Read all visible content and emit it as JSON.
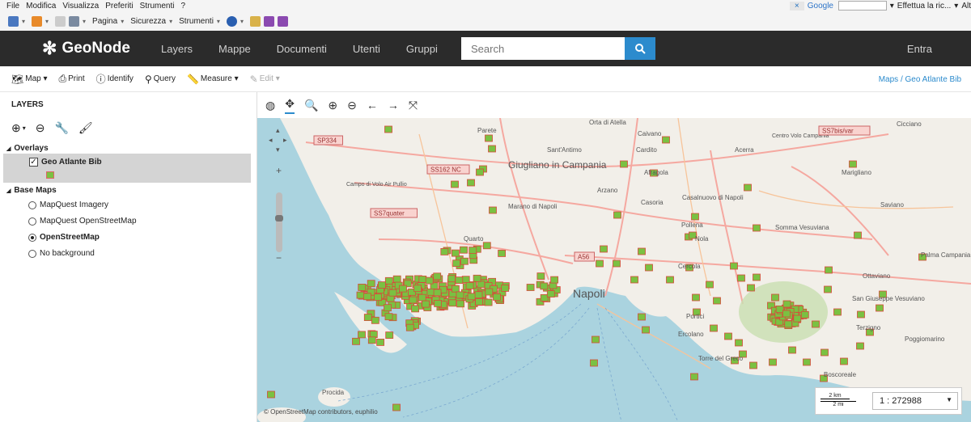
{
  "ie": {
    "menu": [
      "File",
      "Modifica",
      "Visualizza",
      "Preferiti",
      "Strumenti",
      "?"
    ],
    "commands": [
      "Pagina",
      "Sicurezza",
      "Strumenti"
    ],
    "search_provider": "Google",
    "search_label": "Effettua la ric...",
    "search_more": "Alt"
  },
  "navbar": {
    "brand": "GeoNode",
    "items": [
      "Layers",
      "Mappe",
      "Documenti",
      "Utenti",
      "Gruppi"
    ],
    "search_placeholder": "Search",
    "login": "Entra"
  },
  "toolbar": {
    "map": "Map",
    "print": "Print",
    "identify": "Identify",
    "query": "Query",
    "measure": "Measure",
    "edit": "Edit",
    "breadcrumb": "Maps / Geo Atlante Bib"
  },
  "layers_panel": {
    "title": "LAYERS",
    "overlays_label": "Overlays",
    "overlay_layer": "Geo Atlante Bib",
    "basemaps_label": "Base Maps",
    "basemaps": [
      {
        "label": "MapQuest Imagery",
        "selected": false
      },
      {
        "label": "MapQuest OpenStreetMap",
        "selected": false
      },
      {
        "label": "OpenStreetMap",
        "selected": true
      },
      {
        "label": "No background",
        "selected": false
      }
    ]
  },
  "map": {
    "labels": [
      "Orta di Atella",
      "Caivano",
      "Cicciano",
      "Parete",
      "Sant'Antimo",
      "Cardito",
      "Acerra",
      "Centro Volo Campania",
      "Giugliano in Campania",
      "Afragola",
      "Marigliano",
      "Campo di Volo Air Pullio",
      "Arzano",
      "Casoria",
      "Casalnuovo di Napoli",
      "Saviano",
      "Marano di Napoli",
      "Pollena",
      "Nola",
      "Quarto",
      "Somma Vesuviana",
      "Palma Campania",
      "Cercola",
      "Ottaviano",
      "Napoli",
      "San Giuseppe Vesuviano",
      "Portici",
      "Terzigno",
      "Ercolano",
      "Poggiomarino",
      "Torre del Greco",
      "Boscoreale",
      "Procida"
    ],
    "shields": [
      "SP334",
      "SS162 NC",
      "SS7quater",
      "A56",
      "SS7bis/var"
    ],
    "scale_denominator_label": "1 : 272988",
    "scale_bar_top": "2 km",
    "scale_bar_bottom": "2 mi",
    "attribution": "© OpenStreetMap contributors, euphilio",
    "marker_color": "#7ac142",
    "marker_border": "#d64a3a",
    "sea_color": "#aad3df",
    "land_color": "#f2efe9"
  }
}
